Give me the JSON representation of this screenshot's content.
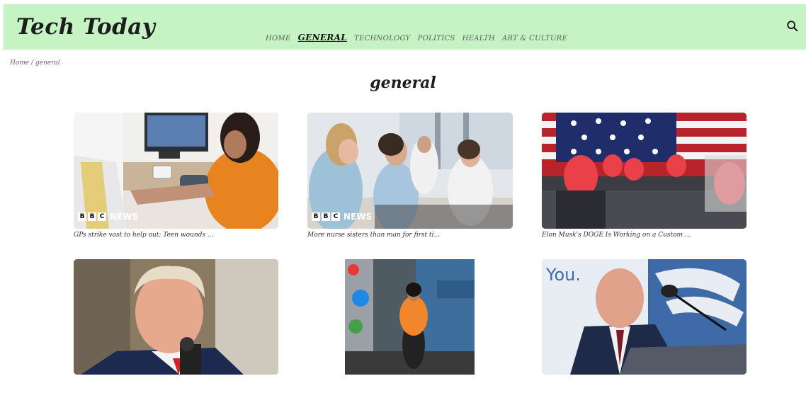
{
  "header": {
    "logo": "Tech Today",
    "nav": [
      {
        "label": "HOME",
        "active": false
      },
      {
        "label": "GENERAL",
        "active": true
      },
      {
        "label": "TECHNOLOGY",
        "active": false
      },
      {
        "label": "POLITICS",
        "active": false
      },
      {
        "label": "HEALTH",
        "active": false
      },
      {
        "label": "ART & CULTURE",
        "active": false
      }
    ],
    "search_icon": "search-icon"
  },
  "breadcrumb": "Home / general",
  "page_title": "general",
  "cards": [
    {
      "caption": "GPs strike vast to help out: Teen wounds ...",
      "badge": "NEWS"
    },
    {
      "caption": "More nurse sisters than man for first ti...",
      "badge": "NEWS"
    },
    {
      "caption": "Elon Musk's DOGE Is Working on a Custom ...",
      "badge": ""
    },
    {
      "caption": "",
      "badge": ""
    },
    {
      "caption": "",
      "badge": ""
    },
    {
      "caption": "",
      "badge": ""
    }
  ],
  "colors": {
    "header_bg": "#c5f3c4",
    "text": "#1d1d1d"
  }
}
